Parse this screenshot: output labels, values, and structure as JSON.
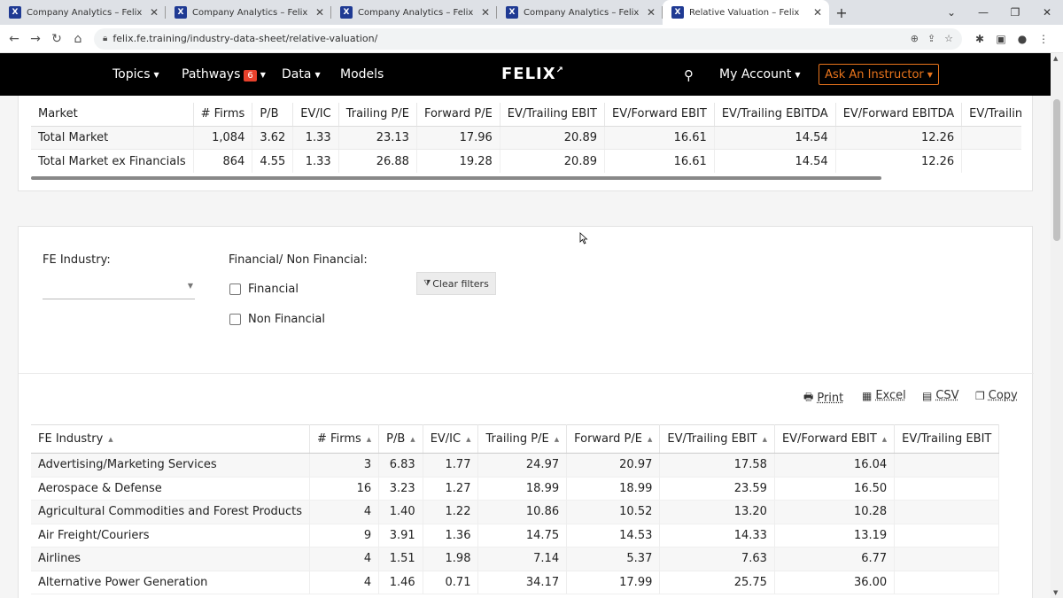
{
  "browser": {
    "tabs": [
      {
        "title": "Company Analytics – Felix",
        "active": false
      },
      {
        "title": "Company Analytics – Felix",
        "active": false
      },
      {
        "title": "Company Analytics – Felix",
        "active": false
      },
      {
        "title": "Company Analytics – Felix",
        "active": false
      },
      {
        "title": "Relative Valuation – Felix",
        "active": true
      }
    ],
    "favicon_letter": "X",
    "url": "felix.fe.training/industry-data-sheet/relative-valuation/"
  },
  "site": {
    "nav": {
      "topics": "Topics",
      "pathways": "Pathways",
      "pathways_badge": "6",
      "data": "Data",
      "models": "Models"
    },
    "logo": "FELIX",
    "my_account": "My Account",
    "ask_instructor": "Ask An Instructor"
  },
  "market_table": {
    "headers": [
      "Market",
      "# Firms",
      "P/B",
      "EV/IC",
      "Trailing P/E",
      "Forward P/E",
      "EV/Trailing EBIT",
      "EV/Forward EBIT",
      "EV/Trailing EBITDA",
      "EV/Forward EBITDA",
      "EV/Trailin"
    ],
    "rows": [
      [
        "Total Market",
        "1,084",
        "3.62",
        "1.33",
        "23.13",
        "17.96",
        "20.89",
        "16.61",
        "14.54",
        "12.26",
        ""
      ],
      [
        "Total Market ex Financials",
        "864",
        "4.55",
        "1.33",
        "26.88",
        "19.28",
        "20.89",
        "16.61",
        "14.54",
        "12.26",
        ""
      ]
    ]
  },
  "filters": {
    "industry_label": "FE Industry:",
    "fin_label": "Financial/ Non Financial:",
    "financial": "Financial",
    "non_financial": "Non Financial",
    "clear": "Clear filters"
  },
  "export": {
    "print": "Print",
    "excel": "Excel",
    "csv": "CSV",
    "copy": "Copy"
  },
  "industry_table": {
    "headers": [
      "FE Industry",
      "# Firms",
      "P/B",
      "EV/IC",
      "Trailing P/E",
      "Forward P/E",
      "EV/Trailing EBIT",
      "EV/Forward EBIT",
      "EV/Trailing EBIT"
    ],
    "rows": [
      [
        "Advertising/Marketing Services",
        "3",
        "6.83",
        "1.77",
        "24.97",
        "20.97",
        "17.58",
        "16.04",
        ""
      ],
      [
        "Aerospace & Defense",
        "16",
        "3.23",
        "1.27",
        "18.99",
        "18.99",
        "23.59",
        "16.50",
        ""
      ],
      [
        "Agricultural Commodities and Forest Products",
        "4",
        "1.40",
        "1.22",
        "10.86",
        "10.52",
        "13.20",
        "10.28",
        ""
      ],
      [
        "Air Freight/Couriers",
        "9",
        "3.91",
        "1.36",
        "14.75",
        "14.53",
        "14.33",
        "13.19",
        ""
      ],
      [
        "Airlines",
        "4",
        "1.51",
        "1.98",
        "7.14",
        "5.37",
        "7.63",
        "6.77",
        ""
      ],
      [
        "Alternative Power Generation",
        "4",
        "1.46",
        "0.71",
        "34.17",
        "17.99",
        "25.75",
        "36.00",
        ""
      ]
    ]
  }
}
